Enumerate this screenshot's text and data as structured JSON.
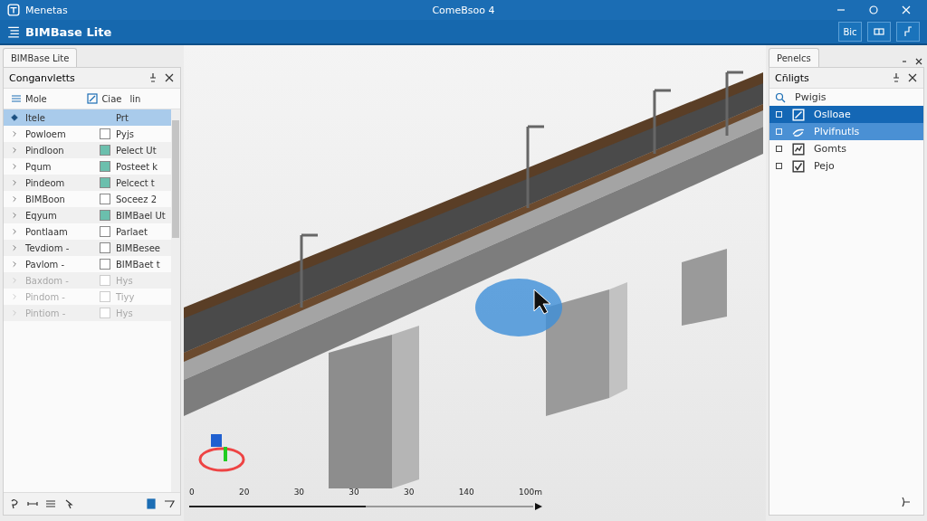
{
  "window": {
    "app_title": "Menetas",
    "title": "ComeBsoo 4"
  },
  "header": {
    "title": "BIMBase Lite",
    "buttons": [
      "Bic"
    ]
  },
  "left_tab": {
    "label": "BIMBase Lite",
    "selected": true
  },
  "components": {
    "title": "Conganvletts",
    "toolbar": [
      "Mole",
      "Ciae",
      "lin"
    ],
    "header_row": {
      "name": "Itele",
      "type": "Prt",
      "selected": true
    },
    "rows": [
      {
        "name": "Powloem",
        "type": "Pyjs",
        "checked": false,
        "disabled": false
      },
      {
        "name": "Pindloon",
        "type": "Pelect Ut",
        "checked": true,
        "disabled": false
      },
      {
        "name": "Pqum",
        "type": "Posteet k",
        "checked": true,
        "disabled": false
      },
      {
        "name": "Pindeom",
        "type": "Pelcect t",
        "checked": true,
        "disabled": false
      },
      {
        "name": "BIMBoon",
        "type": "Soceez 2",
        "checked": false,
        "disabled": false
      },
      {
        "name": "Eqyum",
        "type": "BIMBael Ut",
        "checked": true,
        "disabled": false
      },
      {
        "name": "Pontlaam",
        "type": "Parlaet",
        "checked": false,
        "disabled": false
      },
      {
        "name": "Tevdiom -",
        "type": "BIMBesee",
        "checked": false,
        "disabled": false
      },
      {
        "name": "Pavlom -",
        "type": "BIMBaet t",
        "checked": false,
        "disabled": false
      },
      {
        "name": "Baxdom -",
        "type": "Hys",
        "checked": false,
        "disabled": true
      },
      {
        "name": "Pindom -",
        "type": "Tiyy",
        "checked": false,
        "disabled": true
      },
      {
        "name": "Pintiom -",
        "type": "Hys",
        "checked": false,
        "disabled": true
      }
    ]
  },
  "scale_bar": {
    "labels": [
      "0",
      "20",
      "30",
      "30",
      "30",
      "140",
      "100m"
    ]
  },
  "right_tab": {
    "label": "Penelcs",
    "selected": true
  },
  "objects": {
    "title": "Cñligts",
    "search": {
      "value": "Pwigis"
    },
    "items": [
      {
        "label": "Oslloae",
        "kind": "edit",
        "selected": true,
        "hovered": false
      },
      {
        "label": "Plvifnutls",
        "kind": "shape",
        "selected": false,
        "hovered": true
      },
      {
        "label": "Gomts",
        "kind": "chart",
        "selected": false,
        "hovered": false
      },
      {
        "label": "Pejo",
        "kind": "check",
        "selected": false,
        "hovered": false
      }
    ]
  }
}
